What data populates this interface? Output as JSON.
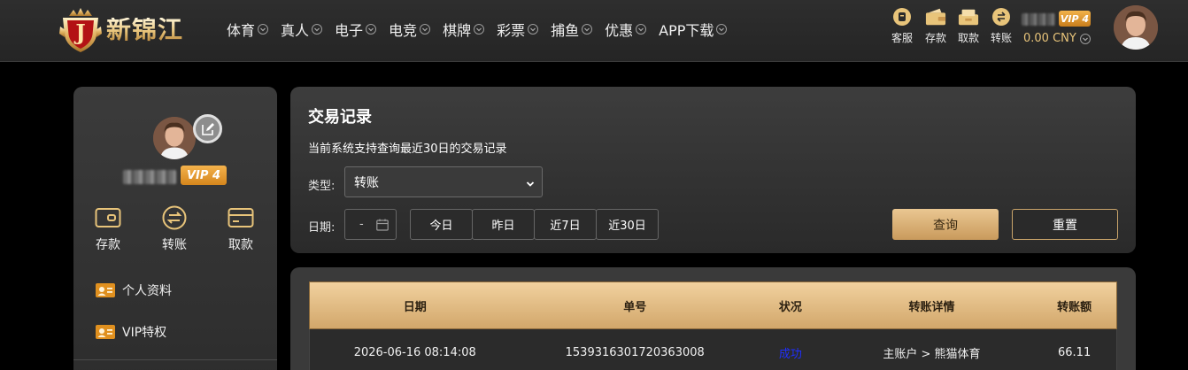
{
  "brand": {
    "name": "新锦江",
    "badge_letter": "J"
  },
  "nav": [
    {
      "label": "体育"
    },
    {
      "label": "真人"
    },
    {
      "label": "电子"
    },
    {
      "label": "电竞"
    },
    {
      "label": "棋牌"
    },
    {
      "label": "彩票"
    },
    {
      "label": "捕鱼"
    },
    {
      "label": "优惠"
    },
    {
      "label": "APP下载"
    }
  ],
  "quick_actions": {
    "service": "客服",
    "deposit": "存款",
    "withdraw": "取款",
    "transfer": "转账"
  },
  "user": {
    "vip": "VIP 4",
    "balance": "0.00 CNY"
  },
  "sidebar": {
    "vip": "VIP 4",
    "actions": {
      "deposit": "存款",
      "transfer": "转账",
      "withdraw": "取款"
    },
    "menu": [
      {
        "label": "个人资料"
      },
      {
        "label": "VIP特权"
      }
    ]
  },
  "query": {
    "title": "交易记录",
    "subtitle": "当前系统支持查询最近30日的交易记录",
    "type_label": "类型:",
    "type_value": "转账",
    "date_label": "日期:",
    "date_value": "-",
    "ranges": [
      {
        "label": "今日"
      },
      {
        "label": "昨日"
      },
      {
        "label": "近7日"
      },
      {
        "label": "近30日"
      }
    ],
    "query_button": "查询",
    "reset_button": "重置"
  },
  "table": {
    "headers": [
      "日期",
      "单号",
      "状况",
      "转账详情",
      "转账额"
    ],
    "rows": [
      [
        "2026-06-16 08:14:08",
        "1539316301720363008",
        "成功",
        "主账户 > 熊猫体育",
        "66.11"
      ]
    ]
  },
  "colors": {
    "accent_gold": "#d2a76b",
    "status_success": "#1f2fff",
    "vip_orange": "#e0901f"
  }
}
